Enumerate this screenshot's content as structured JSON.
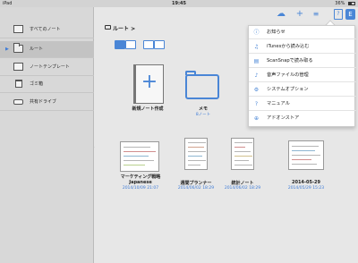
{
  "statusbar": {
    "carrier": "iPad",
    "time": "19:45",
    "battery": "36%"
  },
  "sidebar": {
    "items": [
      {
        "label": "すべてのノート"
      },
      {
        "label": "ルート"
      },
      {
        "label": "ノートテンプレート"
      },
      {
        "label": "ゴミ箱"
      },
      {
        "label": "共有ドライブ"
      }
    ]
  },
  "breadcrumb": {
    "label": "ルート >"
  },
  "tiles": [
    {
      "title": "新規ノート作成",
      "sub": ""
    },
    {
      "title": "メモ",
      "sub": "8ノート"
    }
  ],
  "notes": [
    {
      "title": "マーケティング戦略",
      "title2": "Japanese",
      "date": "2014/10/09 21:07"
    },
    {
      "title": "週間プランナー",
      "date": "2014/06/02 18:29"
    },
    {
      "title": "統計ノート",
      "date": "2014/06/02 18:29"
    },
    {
      "title": "2014-05-29",
      "date": "2014/05/29 15:23"
    }
  ],
  "menu": {
    "items": [
      {
        "label": "お知らせ",
        "icon": "info-icon"
      },
      {
        "label": "iTunesから読み込む",
        "icon": "music-note-icon"
      },
      {
        "label": "ScanSnapで読み取る",
        "icon": "scan-icon"
      },
      {
        "label": "音声ファイルの管理",
        "icon": "audio-file-icon"
      },
      {
        "label": "システムオプション",
        "icon": "gear-icon"
      },
      {
        "label": "マニュアル",
        "icon": "help-icon"
      },
      {
        "label": "アドオンストア",
        "icon": "cart-icon"
      }
    ]
  },
  "accent": "#4a86d6"
}
